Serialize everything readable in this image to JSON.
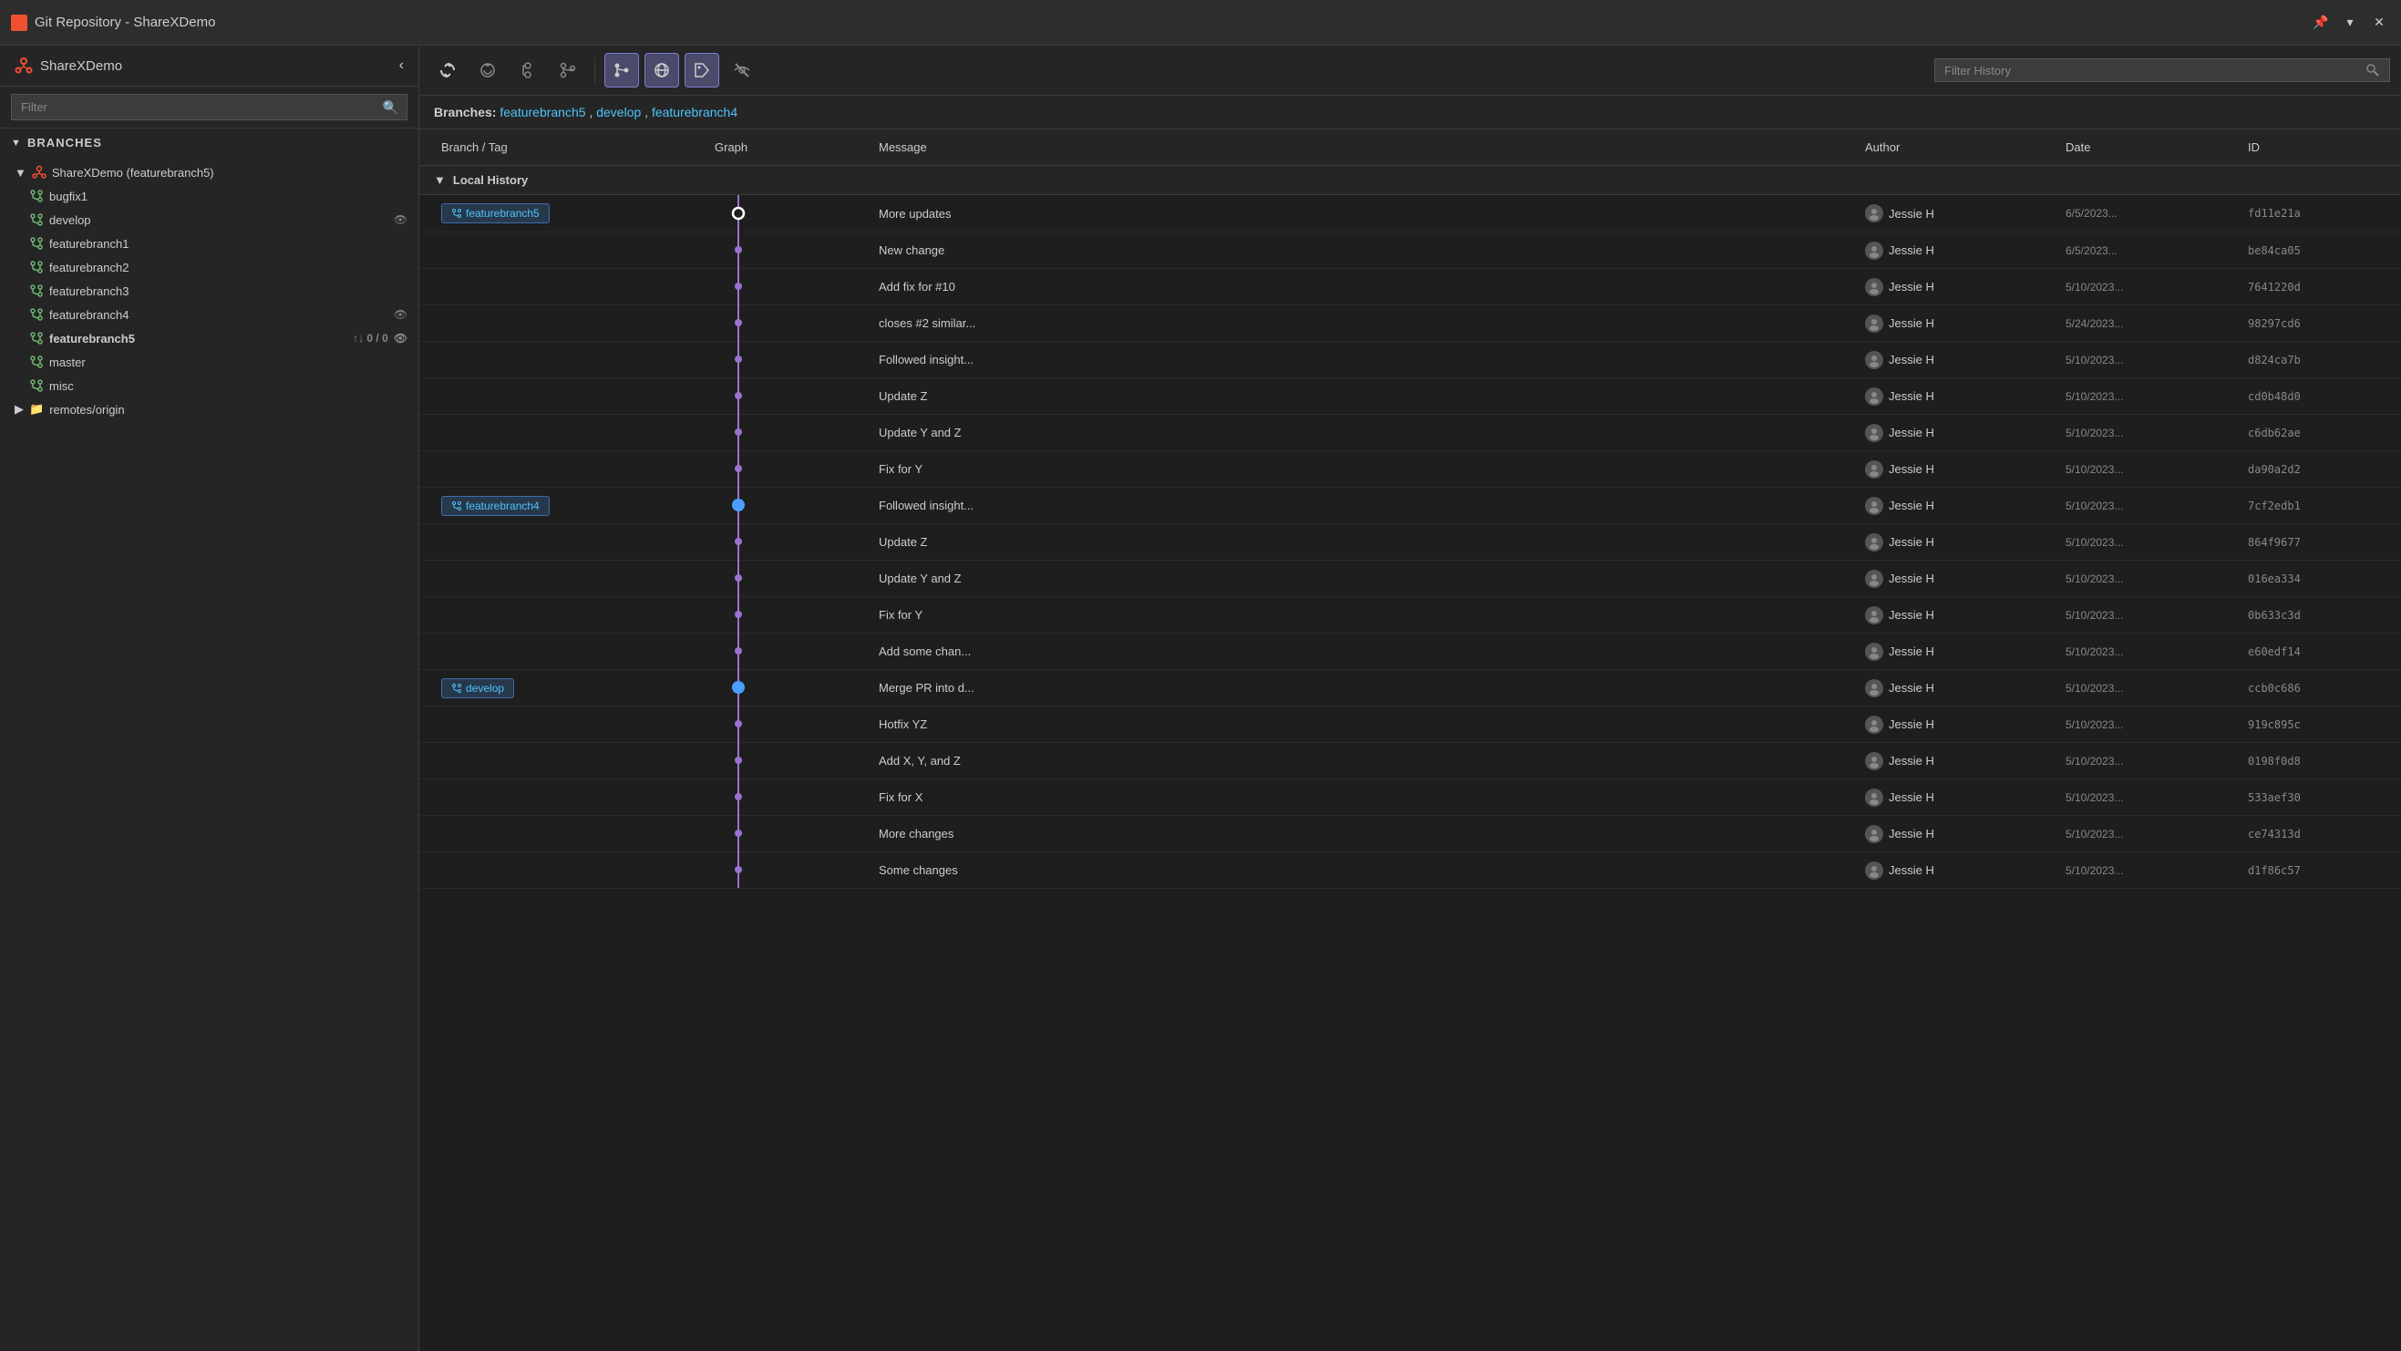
{
  "titleBar": {
    "title": "Git Repository - ShareXDemo",
    "pinLabel": "📌",
    "closeLabel": "✕",
    "dropdownLabel": "▾"
  },
  "sidebar": {
    "repoName": "ShareXDemo",
    "filterPlaceholder": "Filter",
    "sections": {
      "branches": {
        "label": "Branches",
        "items": [
          {
            "name": "ShareXDemo (featurebranch5)",
            "level": 1,
            "isRoot": true,
            "type": "repo"
          },
          {
            "name": "bugfix1",
            "level": 2,
            "type": "branch"
          },
          {
            "name": "develop",
            "level": 2,
            "type": "branch",
            "hasEye": true
          },
          {
            "name": "featurebranch1",
            "level": 2,
            "type": "branch"
          },
          {
            "name": "featurebranch2",
            "level": 2,
            "type": "branch"
          },
          {
            "name": "featurebranch3",
            "level": 2,
            "type": "branch"
          },
          {
            "name": "featurebranch4",
            "level": 2,
            "type": "branch",
            "hasEye": true
          },
          {
            "name": "featurebranch5",
            "level": 2,
            "type": "branch",
            "active": true,
            "badge": "↑↓ 0 / 0",
            "hasEye": true
          },
          {
            "name": "master",
            "level": 2,
            "type": "branch"
          },
          {
            "name": "misc",
            "level": 2,
            "type": "branch"
          }
        ]
      },
      "remotes": {
        "label": "remotes/origin",
        "collapsed": true
      }
    }
  },
  "toolbar": {
    "buttons": [
      {
        "id": "refresh",
        "symbol": "↺",
        "active": false,
        "title": "Refresh"
      },
      {
        "id": "fetch",
        "symbol": "⟳",
        "active": false,
        "title": "Fetch"
      },
      {
        "id": "pull",
        "symbol": "⬇",
        "active": false,
        "title": "Pull"
      },
      {
        "id": "branch",
        "symbol": "⎇",
        "active": false,
        "title": "Branch"
      },
      {
        "id": "commit-graph",
        "symbol": "⬡",
        "active": true,
        "title": "Commit Graph"
      },
      {
        "id": "remotes",
        "symbol": "⊕",
        "active": true,
        "title": "Remotes"
      },
      {
        "id": "tag",
        "symbol": "◇",
        "active": true,
        "title": "Tags"
      },
      {
        "id": "hide",
        "symbol": "⊘",
        "active": false,
        "title": "Hide"
      }
    ],
    "searchPlaceholder": "Filter History"
  },
  "branchesLine": {
    "label": "Branches:",
    "branches": [
      "featurebranch5",
      "develop",
      "featurebranch4"
    ]
  },
  "table": {
    "headers": [
      "Branch / Tag",
      "Graph",
      "Message",
      "Author",
      "Date",
      "ID"
    ],
    "localHistoryLabel": "Local History",
    "rows": [
      {
        "branchTag": "featurebranch5",
        "graphNode": "top",
        "message": "More updates",
        "author": "Jessie H",
        "date": "6/5/2023...",
        "id": "fd11e21a",
        "nodeColor": "#ffffff",
        "nodeType": "circle"
      },
      {
        "branchTag": "",
        "message": "New change",
        "author": "Jessie H",
        "date": "6/5/2023...",
        "id": "be84ca05",
        "nodeType": "dot"
      },
      {
        "branchTag": "",
        "message": "Add fix for #10",
        "author": "Jessie H",
        "date": "5/10/2023...",
        "id": "7641220d",
        "nodeType": "dot"
      },
      {
        "branchTag": "",
        "message": "closes #2 similar...",
        "author": "Jessie H",
        "date": "5/24/2023...",
        "id": "98297cd6",
        "nodeType": "dot"
      },
      {
        "branchTag": "",
        "message": "Followed insight...",
        "author": "Jessie H",
        "date": "5/10/2023...",
        "id": "d824ca7b",
        "nodeType": "dot"
      },
      {
        "branchTag": "",
        "message": "Update Z",
        "author": "Jessie H",
        "date": "5/10/2023...",
        "id": "cd0b48d0",
        "nodeType": "dot"
      },
      {
        "branchTag": "",
        "message": "Update Y and Z",
        "author": "Jessie H",
        "date": "5/10/2023...",
        "id": "c6db62ae",
        "nodeType": "dot"
      },
      {
        "branchTag": "",
        "message": "Fix for Y",
        "author": "Jessie H",
        "date": "5/10/2023...",
        "id": "da90a2d2",
        "nodeType": "dot"
      },
      {
        "branchTag": "featurebranch4",
        "message": "Followed insight...",
        "author": "Jessie H",
        "date": "5/10/2023...",
        "id": "7cf2edb1",
        "nodeColor": "#4a9eff",
        "nodeType": "circle"
      },
      {
        "branchTag": "",
        "message": "Update Z",
        "author": "Jessie H",
        "date": "5/10/2023...",
        "id": "864f9677",
        "nodeType": "dot"
      },
      {
        "branchTag": "",
        "message": "Update Y and Z",
        "author": "Jessie H",
        "date": "5/10/2023...",
        "id": "016ea334",
        "nodeType": "dot"
      },
      {
        "branchTag": "",
        "message": "Fix for Y",
        "author": "Jessie H",
        "date": "5/10/2023...",
        "id": "0b633c3d",
        "nodeType": "dot"
      },
      {
        "branchTag": "",
        "message": "Add some chan...",
        "author": "Jessie H",
        "date": "5/10/2023...",
        "id": "e60edf14",
        "nodeType": "dot"
      },
      {
        "branchTag": "develop",
        "message": "Merge PR into d...",
        "author": "Jessie H",
        "date": "5/10/2023...",
        "id": "ccb0c686",
        "nodeColor": "#4a9eff",
        "nodeType": "circle"
      },
      {
        "branchTag": "",
        "message": "Hotfix YZ",
        "author": "Jessie H",
        "date": "5/10/2023...",
        "id": "919c895c",
        "nodeType": "dot"
      },
      {
        "branchTag": "",
        "message": "Add X, Y, and Z",
        "author": "Jessie H",
        "date": "5/10/2023...",
        "id": "0198f0d8",
        "nodeType": "dot"
      },
      {
        "branchTag": "",
        "message": "Fix for X",
        "author": "Jessie H",
        "date": "5/10/2023...",
        "id": "533aef30",
        "nodeType": "dot"
      },
      {
        "branchTag": "",
        "message": "More changes",
        "author": "Jessie H",
        "date": "5/10/2023...",
        "id": "ce74313d",
        "nodeType": "dot"
      },
      {
        "branchTag": "",
        "message": "Some changes",
        "author": "Jessie H",
        "date": "5/10/2023...",
        "id": "d1f86c57",
        "nodeType": "dot"
      }
    ]
  },
  "colors": {
    "accent": "#4fc3f7",
    "accentBranch": "#4a9eff",
    "nodeWhite": "#ffffff",
    "nodePurple": "#9b72cf",
    "lineColor": "#9b72cf",
    "dotColor": "#9b72cf"
  }
}
